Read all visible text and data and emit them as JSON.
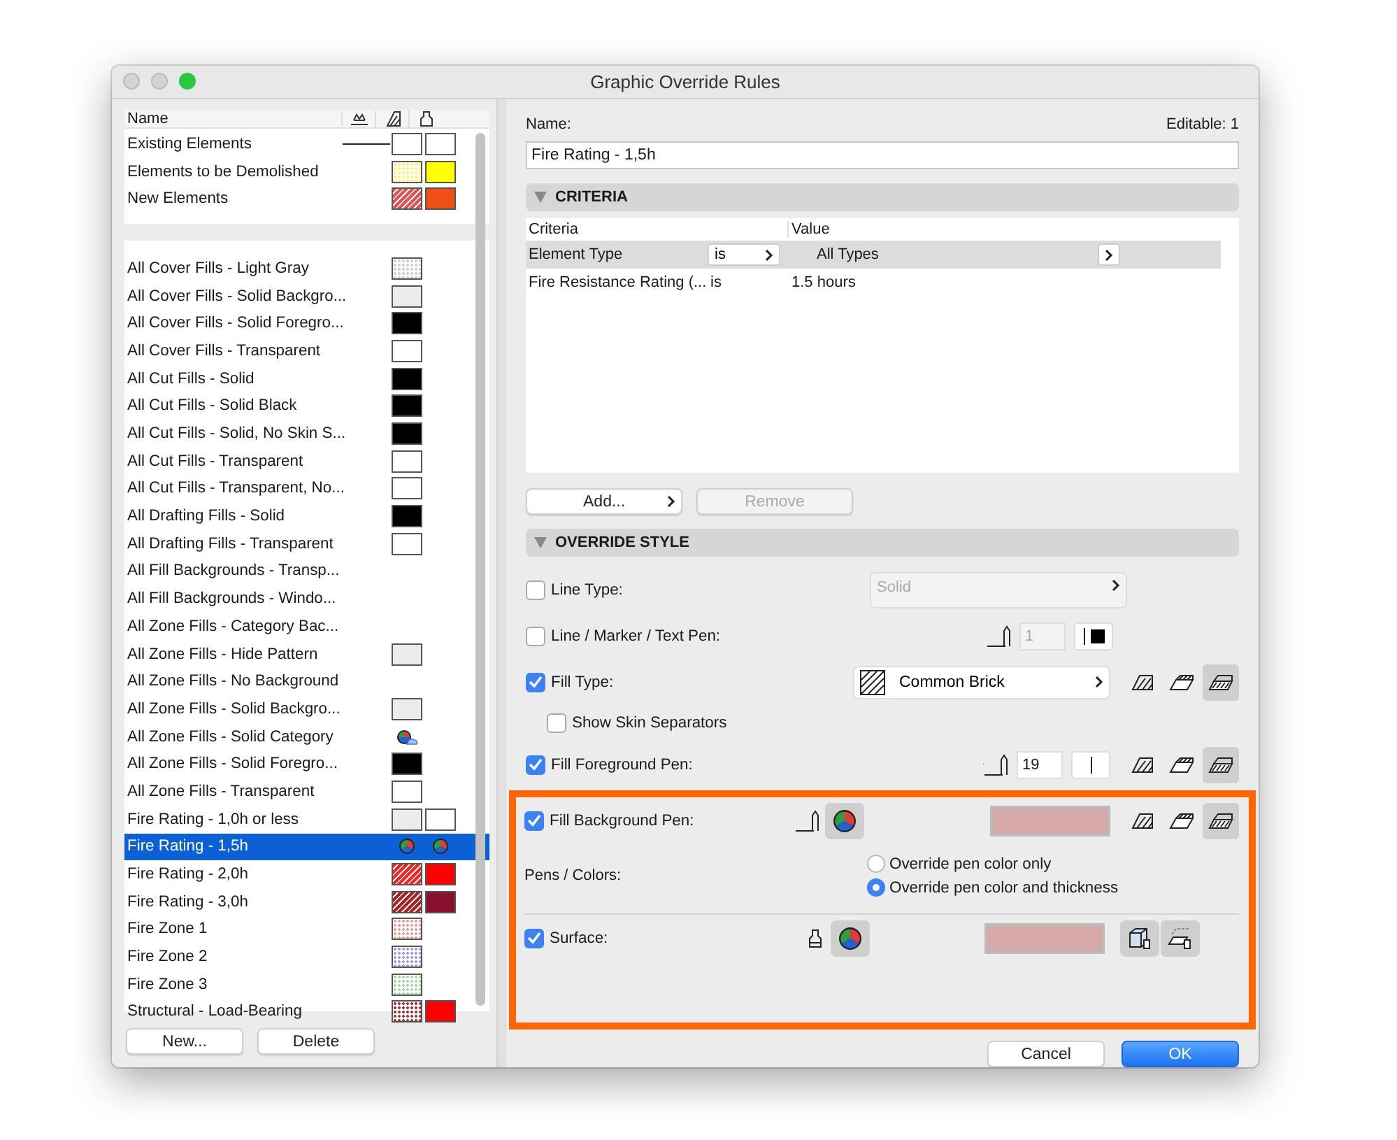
{
  "window": {
    "title": "Graphic Override Rules"
  },
  "rules_list": {
    "header": "Name",
    "top_rows": [
      {
        "name": "Existing Elements",
        "selected": false,
        "line": true,
        "fill": {
          "kind": "solid",
          "color": "#ffffff"
        },
        "surface": {
          "kind": "solid",
          "color": "#ffffff"
        }
      },
      {
        "name": "Elements to be Demolished",
        "selected": false,
        "line": false,
        "fill": {
          "kind": "dots",
          "color": "#fff36a"
        },
        "surface": {
          "kind": "solid",
          "color": "#ffff00"
        }
      },
      {
        "name": "New Elements",
        "selected": false,
        "line": false,
        "fill": {
          "kind": "hatch",
          "color": "#e85050"
        },
        "surface": {
          "kind": "solid",
          "color": "#f05014"
        }
      }
    ],
    "rows": [
      {
        "name": "All Cover Fills - Light Gray",
        "selected": false,
        "fill": {
          "kind": "dots",
          "color": "#cfcfcf"
        }
      },
      {
        "name": "All Cover Fills - Solid Backgro...",
        "selected": false,
        "fill": {
          "kind": "solid",
          "color": "#ececec"
        }
      },
      {
        "name": "All Cover Fills - Solid Foregro...",
        "selected": false,
        "fill": {
          "kind": "solid",
          "color": "#000000"
        }
      },
      {
        "name": "All Cover Fills - Transparent",
        "selected": false,
        "fill": {
          "kind": "solid",
          "color": "#ffffff"
        }
      },
      {
        "name": "All Cut Fills - Solid",
        "selected": false,
        "fill": {
          "kind": "solid",
          "color": "#000000"
        }
      },
      {
        "name": "All Cut Fills - Solid Black",
        "selected": false,
        "fill": {
          "kind": "solid",
          "color": "#000000"
        }
      },
      {
        "name": "All Cut Fills - Solid, No Skin S...",
        "selected": false,
        "fill": {
          "kind": "solid",
          "color": "#000000"
        }
      },
      {
        "name": "All Cut Fills - Transparent",
        "selected": false,
        "fill": {
          "kind": "solid",
          "color": "#ffffff"
        }
      },
      {
        "name": "All Cut Fills - Transparent, No...",
        "selected": false,
        "fill": {
          "kind": "solid",
          "color": "#ffffff"
        }
      },
      {
        "name": "All Drafting Fills - Solid",
        "selected": false,
        "fill": {
          "kind": "solid",
          "color": "#000000"
        }
      },
      {
        "name": "All Drafting Fills - Transparent",
        "selected": false,
        "fill": {
          "kind": "solid",
          "color": "#ffffff"
        }
      },
      {
        "name": "All Fill Backgrounds - Transp...",
        "selected": false
      },
      {
        "name": "All Fill Backgrounds - Windo...",
        "selected": false
      },
      {
        "name": "All Zone Fills - Category Bac...",
        "selected": false
      },
      {
        "name": "All Zone Fills - Hide Pattern",
        "selected": false,
        "fill": {
          "kind": "solid",
          "color": "#ececec"
        }
      },
      {
        "name": "All Zone Fills - No Background",
        "selected": false
      },
      {
        "name": "All Zone Fills - Solid Backgro...",
        "selected": false,
        "fill": {
          "kind": "solid",
          "color": "#ececec"
        }
      },
      {
        "name": "All Zone Fills - Solid Category",
        "selected": false,
        "fill": {
          "kind": "category"
        }
      },
      {
        "name": "All Zone Fills - Solid Foregro...",
        "selected": false,
        "fill": {
          "kind": "solid",
          "color": "#000000"
        }
      },
      {
        "name": "All Zone Fills - Transparent",
        "selected": false,
        "fill": {
          "kind": "solid",
          "color": "#ffffff"
        }
      },
      {
        "name": "Fire Rating - 1,0h or less",
        "selected": false,
        "fill": {
          "kind": "solid",
          "color": "#ececec"
        },
        "surface": {
          "kind": "solid",
          "color": "#ffffff"
        }
      },
      {
        "name": "Fire Rating - 1,5h",
        "selected": true,
        "fill": {
          "kind": "pen-color"
        },
        "surface": {
          "kind": "pen-color"
        }
      },
      {
        "name": "Fire Rating - 2,0h",
        "selected": false,
        "fill": {
          "kind": "hatch",
          "color": "#ff2020"
        },
        "surface": {
          "kind": "solid",
          "color": "#ff0000"
        }
      },
      {
        "name": "Fire Rating - 3,0h",
        "selected": false,
        "fill": {
          "kind": "hatch",
          "color": "#b02020"
        },
        "surface": {
          "kind": "solid",
          "color": "#8b1030"
        }
      },
      {
        "name": "Fire Zone 1",
        "selected": false,
        "fill": {
          "kind": "dots",
          "color": "#f09a9a"
        }
      },
      {
        "name": "Fire Zone 2",
        "selected": false,
        "fill": {
          "kind": "dots",
          "color": "#9c9cf0"
        }
      },
      {
        "name": "Fire Zone 3",
        "selected": false,
        "fill": {
          "kind": "dots",
          "color": "#9fdcaa"
        }
      },
      {
        "name": "Structural - Load-Bearing",
        "selected": false,
        "fill": {
          "kind": "dots",
          "color": "#b03030"
        },
        "surface": {
          "kind": "solid",
          "color": "#ff0000"
        }
      }
    ],
    "buttons": [
      "New...",
      "Delete"
    ]
  },
  "rule": {
    "name_label": "Name:",
    "editable": "Editable: 1",
    "name_value": "Fire Rating - 1,5h",
    "criteria": {
      "title": "CRITERIA",
      "expanded": true,
      "columns": [
        "Criteria",
        "Value"
      ],
      "rows": [
        {
          "criteria": "Element Type",
          "operator": "is",
          "value": "All Types",
          "selected": true
        },
        {
          "criteria": "Fire Resistance Rating (...",
          "operator": "is",
          "value": "1.5 hours",
          "selected": false
        }
      ],
      "add_button": "Add...",
      "remove_button": {
        "label": "Remove",
        "disabled": true
      }
    },
    "override": {
      "title": "OVERRIDE STYLE",
      "expanded": true,
      "items": [
        {
          "kind": "popup",
          "label": "Line Type:",
          "checked": false,
          "value": "Solid",
          "disabled": true
        },
        {
          "kind": "pen",
          "label": "Line / Marker / Text Pen:",
          "checked": false,
          "pen_number": "1",
          "disabled": true,
          "color": "#000000"
        },
        {
          "kind": "fill-type",
          "label": "Fill Type:",
          "checked": true,
          "value": "Common Brick",
          "fill_buttons": [
            {
              "selected": false
            },
            {
              "selected": false
            },
            {
              "selected": true
            }
          ]
        },
        {
          "kind": "sub-checkbox",
          "label": "Show Skin Separators",
          "checked": false
        },
        {
          "kind": "pen",
          "label": "Fill Foreground Pen:",
          "checked": true,
          "pen_number": "19",
          "disabled": false,
          "fill_buttons": [
            {
              "selected": false
            },
            {
              "selected": false
            },
            {
              "selected": true
            }
          ]
        }
      ],
      "highlight_items": [
        {
          "kind": "pen-color",
          "label": "Fill Background Pen:",
          "checked": true,
          "color": "#d6a9a9",
          "fill_buttons": [
            {
              "selected": false
            },
            {
              "selected": false
            },
            {
              "selected": true
            }
          ]
        },
        {
          "kind": "radio",
          "label": "Pens / Colors:",
          "options": [
            {
              "label": "Override pen color only",
              "selected": false
            },
            {
              "label": "Override pen color and thickness",
              "selected": true
            }
          ]
        },
        {
          "kind": "surface",
          "label": "Surface:",
          "checked": true,
          "color": "#d6a9a9"
        }
      ]
    }
  },
  "footer": {
    "cancel": "Cancel",
    "ok": "OK"
  }
}
